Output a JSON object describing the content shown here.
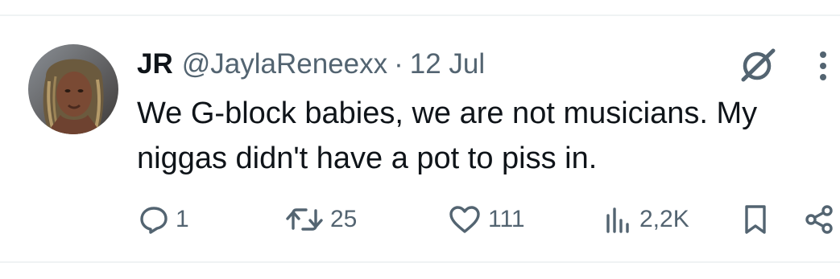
{
  "tweet": {
    "author_name": "JR",
    "handle": "@JaylaReneexx",
    "separator": "·",
    "date": "12 Jul",
    "text": "We G-block babies, we are not musicians. My niggas didn't have a pot to piss in."
  },
  "actions": {
    "replies": "1",
    "reposts": "25",
    "likes": "111",
    "views": "2,2K"
  },
  "icons": {
    "grok": "grok-icon",
    "more": "more-icon",
    "reply": "reply-icon",
    "repost": "repost-icon",
    "like": "heart-icon",
    "views": "views-icon",
    "bookmark": "bookmark-icon",
    "share": "share-icon"
  },
  "colors": {
    "text_primary": "#0f1419",
    "text_secondary": "#536471",
    "divider": "#eff3f4"
  }
}
